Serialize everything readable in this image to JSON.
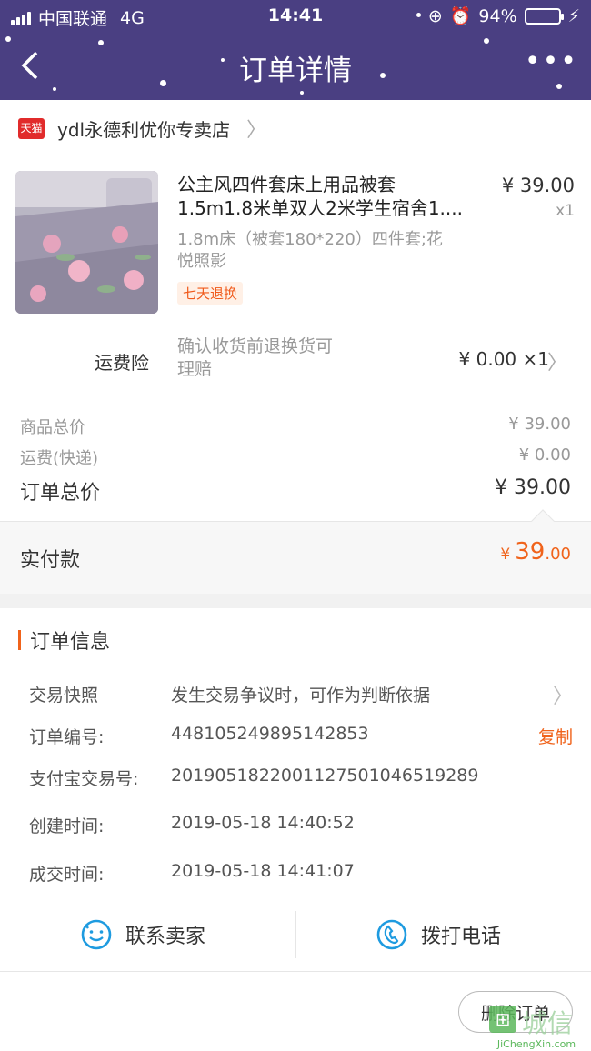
{
  "status_bar": {
    "carrier": "中国联通",
    "network": "4G",
    "time": "14:41",
    "battery": "94%",
    "battery_level": 0.94
  },
  "nav": {
    "title": "订单详情",
    "back_icon": "chevron-left-icon",
    "more_icon": "more-dots-icon"
  },
  "shop": {
    "badge": "天猫",
    "name": "ydl永德利优你专卖店"
  },
  "product": {
    "title_line1": "公主风四件套床上用品被套",
    "title_line2": "1.5m1.8米单双人2米学生宿舍1....",
    "sku_line1": "1.8m床（被套180*220）四件套;花",
    "sku_line2": "悦照影",
    "tag": "七天退换",
    "price": "¥ 39.00",
    "qty": "x1"
  },
  "insurance": {
    "label": "运费险",
    "desc_line1": "确认收货前退换货可",
    "desc_line2": "理赔",
    "price": "¥ 0.00 ×1"
  },
  "totals": {
    "goods_label": "商品总价",
    "goods_value": "¥ 39.00",
    "shipping_label": "运费(快递)",
    "shipping_value": "¥ 0.00",
    "order_label": "订单总价",
    "order_value": "¥ 39.00"
  },
  "payment": {
    "label": "实付款",
    "currency": "¥",
    "integer": "39",
    "decimal": ".00"
  },
  "order_info": {
    "title": "订单信息",
    "snapshot_label": "交易快照",
    "snapshot_value": "发生交易争议时，可作为判断依据",
    "order_no_label": "订单编号:",
    "order_no_value": "448105249895142853",
    "copy_label": "复制",
    "alipay_label": "支付宝交易号:",
    "alipay_value": "2019051822001127501046519289",
    "created_label": "创建时间:",
    "created_value": "2019-05-18 14:40:52",
    "deal_label": "成交时间:",
    "deal_value": "2019-05-18 14:41:07"
  },
  "contact": {
    "seller_label": "联系卖家",
    "phone_label": "拨打电话"
  },
  "actions": {
    "delete_label": "删除订单"
  },
  "watermark": {
    "cn": "城信",
    "en": "JiChengXin.com"
  },
  "colors": {
    "header_bg": "#4a3f82",
    "accent": "#f0631b",
    "tmall_red": "#e12b2b",
    "icon_blue": "#1e9be0"
  }
}
